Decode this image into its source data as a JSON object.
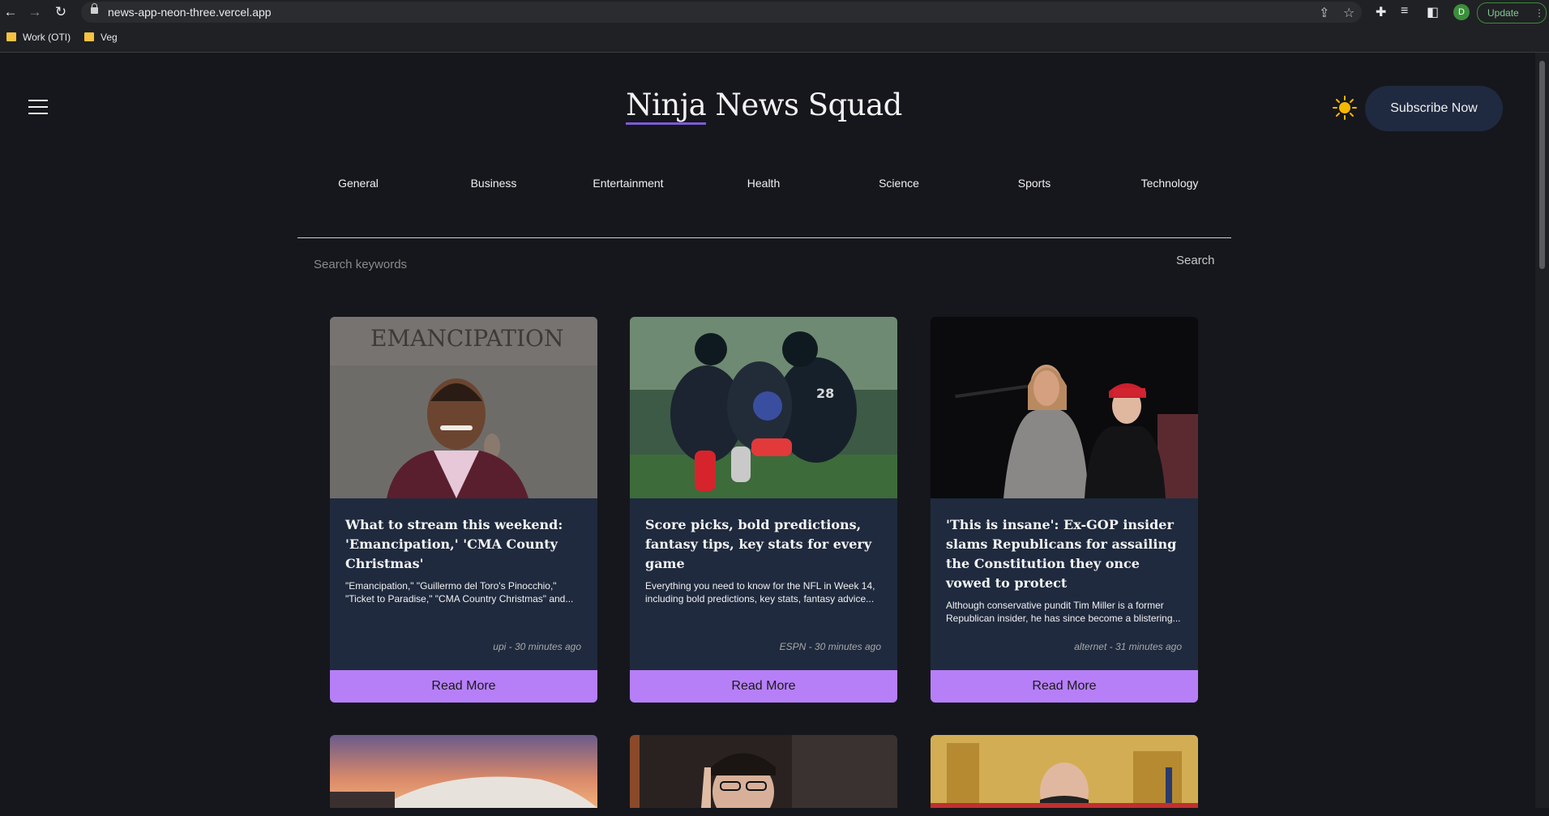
{
  "browser": {
    "url": "news-app-neon-three.vercel.app",
    "profile_initial": "D",
    "update_label": "Update",
    "bookmarks": [
      "Work (OTI)",
      "Veg"
    ]
  },
  "header": {
    "title_part1": "Ninja",
    "title_part2": " News Squad",
    "subscribe_label": "Subscribe Now"
  },
  "categories": [
    "General",
    "Business",
    "Entertainment",
    "Health",
    "Science",
    "Sports",
    "Technology"
  ],
  "search": {
    "placeholder": "Search keywords",
    "button_label": "Search"
  },
  "articles": [
    {
      "title": "What to stream this weekend: 'Emancipation,' 'CMA County Christmas'",
      "description": "\"Emancipation,\" \"Guillermo del Toro's Pinocchio,\" \"Ticket to Paradise,\" \"CMA Country Christmas\" and...",
      "meta": "upi - 30 minutes ago",
      "read_more": "Read More",
      "image_text": "EMANCIPATION"
    },
    {
      "title": "Score picks, bold predictions, fantasy tips, key stats for every game",
      "description": "Everything you need to know for the NFL in Week 14, including bold predictions, key stats, fantasy advice...",
      "meta": "ESPN - 30 minutes ago",
      "read_more": "Read More"
    },
    {
      "title": "'This is insane': Ex-GOP insider slams Republicans for assailing the Constitution they once vowed to protect",
      "description": "Although conservative pundit Tim Miller is a former Republican insider, he has since become a blistering...",
      "meta": "alternet - 31 minutes ago",
      "read_more": "Read More"
    }
  ],
  "colors": {
    "background": "#16171c",
    "card": "#1f2a3e",
    "accent": "#b67ff7",
    "subscribe": "#1f2a40",
    "sun": "#f5b800"
  },
  "icons": [
    "back-arrow-icon",
    "forward-arrow-icon",
    "reload-icon",
    "lock-icon",
    "share-icon",
    "star-icon",
    "puzzle-icon",
    "reading-list-icon",
    "sidepanel-icon",
    "menu-dots-icon",
    "hamburger-icon",
    "sun-icon",
    "folder-icon"
  ]
}
